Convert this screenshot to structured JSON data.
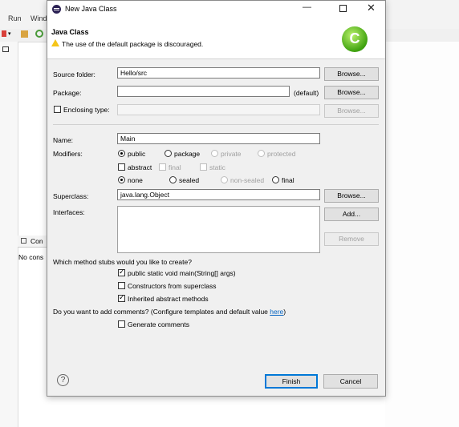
{
  "background": {
    "menu": [
      "Run",
      "Wind"
    ],
    "console_tab": "Con",
    "console_text": "No cons"
  },
  "dialog": {
    "title": "New Java Class",
    "title_icon": "eclipse-icon",
    "banner": {
      "heading": "Java Class",
      "message": "The use of the default package is discouraged.",
      "warning_icon": "warning-icon",
      "wizard_icon": "new-class-icon"
    },
    "source_folder": {
      "label": "Source folder:",
      "value": "Hello/src",
      "browse": "Browse..."
    },
    "package": {
      "label": "Package:",
      "value": "",
      "default_text": "(default)",
      "browse": "Browse..."
    },
    "enclosing": {
      "label": "Enclosing type:",
      "value": "",
      "browse": "Browse..."
    },
    "name": {
      "label": "Name:",
      "value": "Main"
    },
    "modifiers": {
      "label": "Modifiers:",
      "access": [
        "public",
        "package",
        "private",
        "protected"
      ],
      "access_selected": "public",
      "flags": [
        "abstract",
        "final",
        "static"
      ],
      "sealing": [
        "none",
        "sealed",
        "non-sealed",
        "final"
      ],
      "sealing_selected": "none"
    },
    "superclass": {
      "label": "Superclass:",
      "value": "java.lang.Object",
      "browse": "Browse..."
    },
    "interfaces": {
      "label": "Interfaces:",
      "add": "Add...",
      "remove": "Remove"
    },
    "stubs": {
      "question": "Which method stubs would you like to create?",
      "items": [
        {
          "label": "public static void main(String[] args)",
          "checked": true
        },
        {
          "label": "Constructors from superclass",
          "checked": false
        },
        {
          "label": "Inherited abstract methods",
          "checked": true
        }
      ]
    },
    "comments": {
      "question": "Do you want to add comments? (Configure templates and default value ",
      "link": "here",
      "suffix": ")",
      "generate": "Generate comments"
    },
    "footer": {
      "help_icon": "help-icon",
      "finish": "Finish",
      "cancel": "Cancel"
    }
  }
}
